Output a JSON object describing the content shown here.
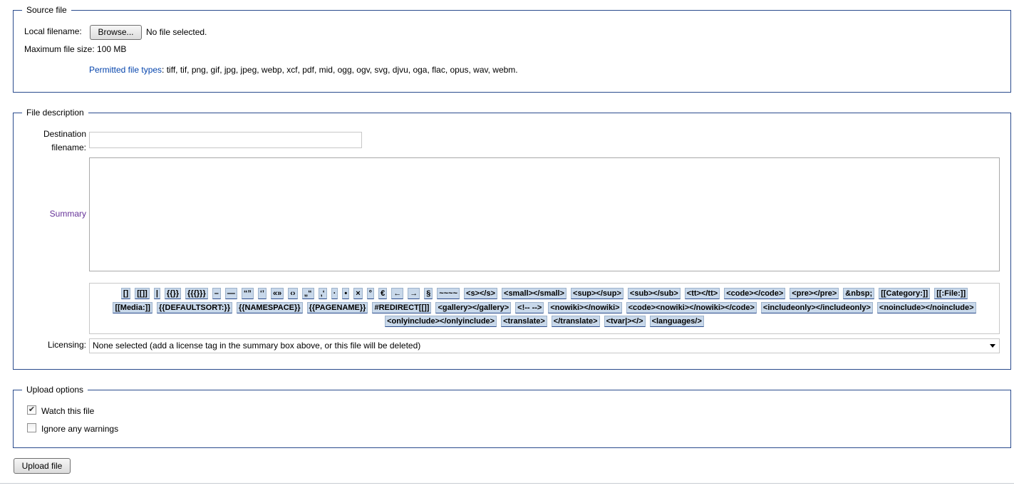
{
  "source_file": {
    "legend": "Source file",
    "local_filename_label": "Local filename:",
    "browse_label": "Browse...",
    "no_file_text": "No file selected.",
    "max_size_label": "Maximum file size:",
    "max_size_value": "100 MB",
    "permitted_link": "Permitted file types",
    "permitted_types": ": tiff, tif, png, gif, jpg, jpeg, webp, xcf, pdf, mid, ogg, ogv, svg, djvu, oga, flac, opus, wav, webm."
  },
  "file_description": {
    "legend": "File description",
    "dest_label_1": "Destination",
    "dest_label_2": "filename:",
    "dest_value": "",
    "summary_label": "Summary",
    "summary_value": "",
    "special_chars": [
      "[]",
      "[[]]",
      "|",
      "{{}}",
      "{{{}}}",
      "–",
      "—",
      "“”",
      "‘’",
      "«»",
      "‹›",
      "„“",
      "‚‘",
      "·",
      "•",
      "×",
      "°",
      "€",
      "←",
      "→",
      "§",
      "~~~~",
      "<s></s>",
      "<small></small>",
      "<sup></sup>",
      "<sub></sub>",
      "<tt></tt>",
      "<code></code>",
      "<pre></pre>",
      "&nbsp;",
      "[[Category:]]",
      "[[:File:]]",
      "[[Media:]]",
      "{{DEFAULTSORT:}}",
      "{{NAMESPACE}}",
      "{{PAGENAME}}",
      "#REDIRECT[[]]",
      "<gallery></gallery>",
      "<!-- -->",
      "<nowiki></nowiki>",
      "<code><nowiki></nowiki></code>",
      "<includeonly></includeonly>",
      "<noinclude></noinclude>",
      "<onlyinclude></onlyinclude>",
      "<translate>",
      "</translate>",
      "<tvar|></>",
      "<languages/>"
    ],
    "licensing_label": "Licensing:",
    "licensing_selected": "None selected (add a license tag in the summary box above, or this file will be deleted)"
  },
  "upload_options": {
    "legend": "Upload options",
    "watch_label": "Watch this file",
    "watch_checked": true,
    "ignore_label": "Ignore any warnings",
    "ignore_checked": false
  },
  "upload_button_label": "Upload file"
}
